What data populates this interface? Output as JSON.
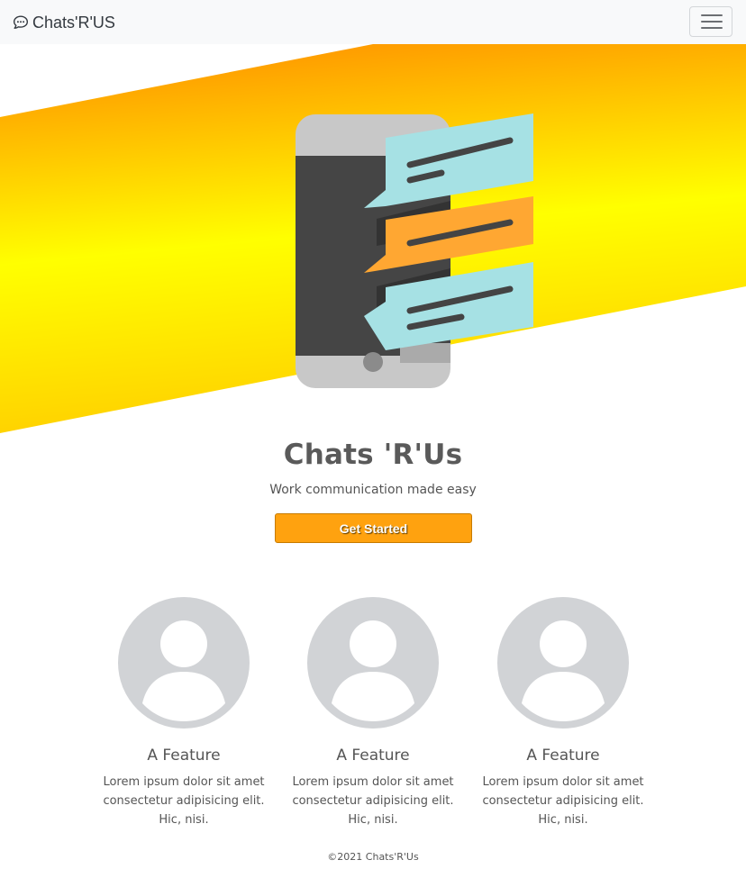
{
  "navbar": {
    "brand": "Chats'R'US",
    "menu_icon": "hamburger-menu-icon"
  },
  "hero": {
    "gradient_colors": [
      "#ff8800",
      "#ffff00"
    ],
    "illustration_icon": "phone-chat-illustration"
  },
  "main": {
    "title": "Chats 'R'Us",
    "subtitle": "Work communication made easy",
    "cta_label": "Get Started",
    "cta_color": "#ffa20f"
  },
  "features": [
    {
      "icon": "user-avatar-icon",
      "title": "A Feature",
      "text": "Lorem ipsum dolor sit amet consectetur adipisicing elit. Hic, nisi."
    },
    {
      "icon": "user-avatar-icon",
      "title": "A Feature",
      "text": "Lorem ipsum dolor sit amet consectetur adipisicing elit. Hic, nisi."
    },
    {
      "icon": "user-avatar-icon",
      "title": "A Feature",
      "text": "Lorem ipsum dolor sit amet consectetur adipisicing elit. Hic, nisi."
    }
  ],
  "footer": {
    "copyright": "©2021 Chats'R'Us"
  }
}
